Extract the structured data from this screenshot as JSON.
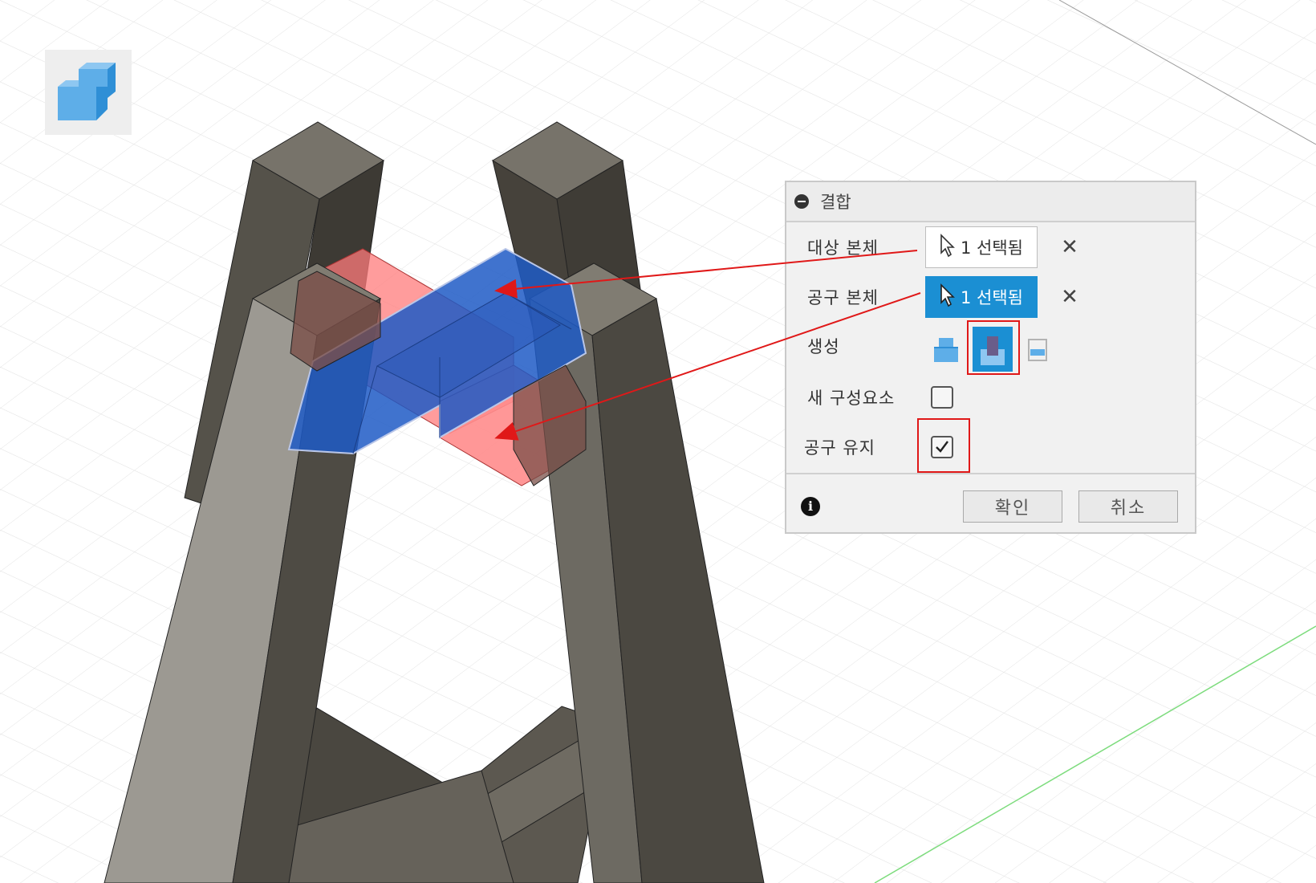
{
  "dialog": {
    "title": "결합",
    "rows": {
      "target_body": {
        "label": "대상 본체",
        "selection": "1 선택됨"
      },
      "tool_body": {
        "label": "공구 본체",
        "selection": "1 선택됨"
      },
      "operation": {
        "label": "생성",
        "options": [
          "join-icon",
          "cut-icon",
          "intersect-icon"
        ],
        "selected": "cut-icon"
      },
      "new_component": {
        "label": "새 구성요소",
        "checked": false
      },
      "keep_tools": {
        "label": "공구 유지",
        "checked": true
      }
    },
    "ok_label": "확인",
    "cancel_label": "취소"
  },
  "colors": {
    "accent": "#1b8fd3",
    "highlight": "#e01818",
    "solid_body": "#6a665d",
    "tool_body": "#1e5bc6",
    "target_body": "#ff7b7b"
  }
}
